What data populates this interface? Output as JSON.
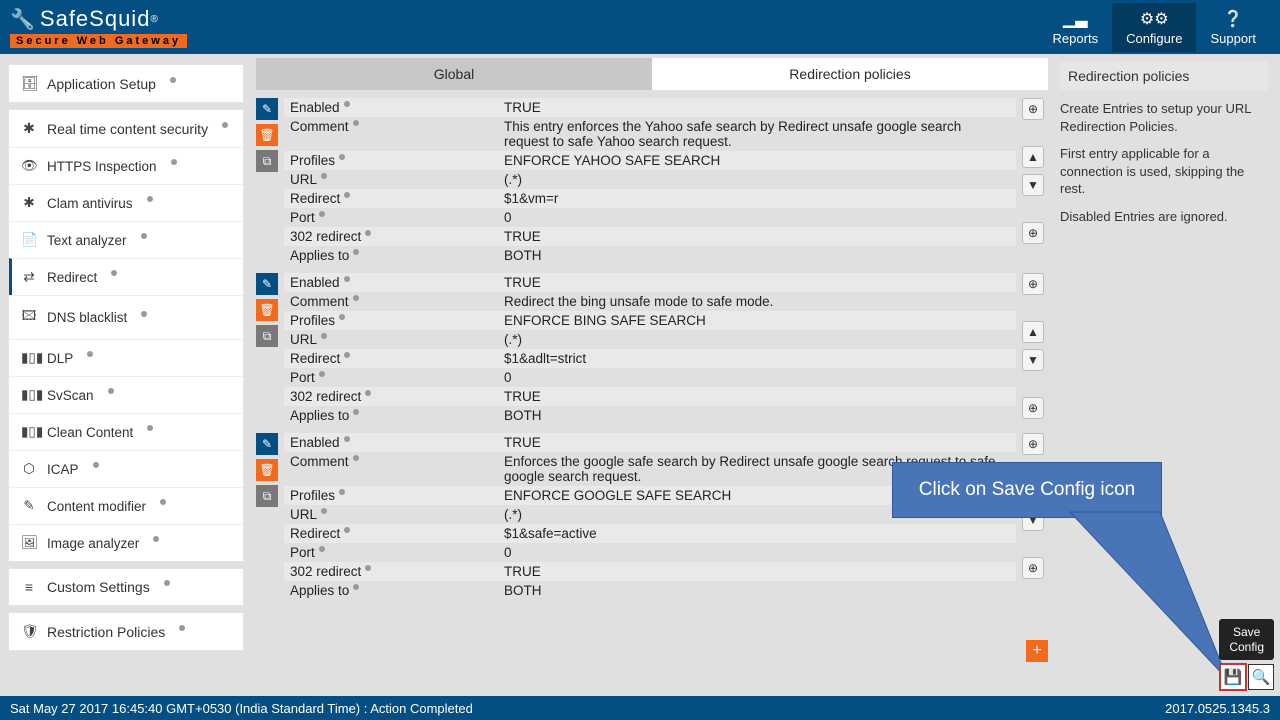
{
  "brand": {
    "name": "SafeSquid",
    "reg": "®",
    "sub": "Secure Web Gateway"
  },
  "topnav": [
    {
      "label": "Reports",
      "icon": "chart"
    },
    {
      "label": "Configure",
      "icon": "cogs"
    },
    {
      "label": "Support",
      "icon": "help"
    }
  ],
  "sidebar": {
    "groups": [
      {
        "head": "Application Setup",
        "items": []
      },
      {
        "head": "Real time content security",
        "items": [
          {
            "label": "HTTPS Inspection",
            "icon": "eye"
          },
          {
            "label": "Clam antivirus",
            "icon": "asterisk"
          },
          {
            "label": "Text analyzer",
            "icon": "file"
          },
          {
            "label": "Redirect",
            "icon": "shuffle",
            "active": true
          },
          {
            "label": "DNS blacklist",
            "icon": "db"
          },
          {
            "label": "DLP",
            "icon": "barcode"
          },
          {
            "label": "SvScan",
            "icon": "barcode"
          },
          {
            "label": "Clean Content",
            "icon": "barcode"
          },
          {
            "label": "ICAP",
            "icon": "gear"
          },
          {
            "label": "Content modifier",
            "icon": "edit"
          },
          {
            "label": "Image analyzer",
            "icon": "image"
          }
        ]
      },
      {
        "head": "Custom Settings",
        "items": []
      },
      {
        "head": "Restriction Policies",
        "items": []
      }
    ]
  },
  "tabs": [
    {
      "label": "Global"
    },
    {
      "label": "Redirection policies"
    }
  ],
  "entries": [
    {
      "rows": [
        {
          "k": "Enabled",
          "v": "TRUE"
        },
        {
          "k": "Comment",
          "v": "This entry enforces the Yahoo safe search by Redirect unsafe google search request to safe Yahoo search request."
        },
        {
          "k": "Profiles",
          "v": "ENFORCE YAHOO SAFE SEARCH"
        },
        {
          "k": "URL",
          "v": "(.*)"
        },
        {
          "k": "Redirect",
          "v": "$1&vm=r"
        },
        {
          "k": "Port",
          "v": "0"
        },
        {
          "k": "302 redirect",
          "v": "TRUE"
        },
        {
          "k": "Applies to",
          "v": "BOTH"
        }
      ]
    },
    {
      "rows": [
        {
          "k": "Enabled",
          "v": "TRUE"
        },
        {
          "k": "Comment",
          "v": "Redirect the bing unsafe mode to safe mode."
        },
        {
          "k": "Profiles",
          "v": "ENFORCE BING SAFE SEARCH"
        },
        {
          "k": "URL",
          "v": "(.*)"
        },
        {
          "k": "Redirect",
          "v": "$1&adlt=strict"
        },
        {
          "k": "Port",
          "v": "0"
        },
        {
          "k": "302 redirect",
          "v": "TRUE"
        },
        {
          "k": "Applies to",
          "v": "BOTH"
        }
      ]
    },
    {
      "rows": [
        {
          "k": "Enabled",
          "v": "TRUE"
        },
        {
          "k": "Comment",
          "v": "Enforces the google safe search by Redirect unsafe google search request to safe google search request."
        },
        {
          "k": "Profiles",
          "v": "ENFORCE GOOGLE SAFE SEARCH"
        },
        {
          "k": "URL",
          "v": "(.*)"
        },
        {
          "k": "Redirect",
          "v": "$1&safe=active"
        },
        {
          "k": "Port",
          "v": "0"
        },
        {
          "k": "302 redirect",
          "v": "TRUE"
        },
        {
          "k": "Applies to",
          "v": "BOTH"
        }
      ]
    }
  ],
  "rightpanel": {
    "title": "Redirection policies",
    "p1": "Create Entries to setup your URL Redirection Policies.",
    "p2": "First entry applicable for a connection is used, skipping the rest.",
    "p3": "Disabled Entries are ignored."
  },
  "callout": "Click on Save Config icon",
  "tooltip": "Save\nConfig",
  "footer": {
    "left": "Sat May 27 2017 16:45:40 GMT+0530 (India Standard Time) : Action Completed",
    "right": "2017.0525.1345.3"
  },
  "icons": {
    "briefcase": "💼",
    "shield": "✱",
    "eye": "👁",
    "asterisk": "✱",
    "file": "📄",
    "shuffle": "✖",
    "db": "🖾",
    "barcode": "▮▯▮",
    "gear": "⚙",
    "edit": "✎",
    "image": "🖼",
    "sliders": "≡",
    "ushield": "🛡",
    "pencil": "✎",
    "trash": "🗑",
    "copy": "⧉",
    "circleplus": "⊕",
    "up": "▲",
    "down": "▼",
    "plus": "+",
    "save": "💾",
    "search": "🔍",
    "chart": "▁▃",
    "cogs": "⚙",
    "help": "?"
  }
}
